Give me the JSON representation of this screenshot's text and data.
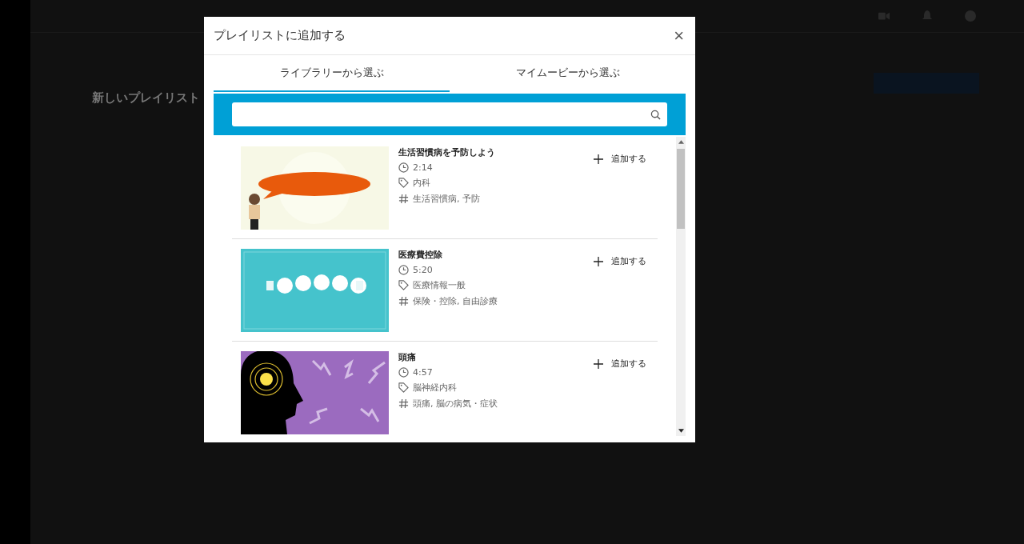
{
  "background_page": {
    "title": "新しいプレイリスト"
  },
  "dialog": {
    "title": "プレイリストに追加する",
    "close": "×",
    "tabs": [
      {
        "label": "ライブラリーから選ぶ",
        "selected": true
      },
      {
        "label": "マイムービーから選ぶ",
        "selected": false
      }
    ],
    "videos": [
      {
        "title": "生活習慣病を予防しよう",
        "duration": "2:14",
        "category": "内科",
        "tags": "生活習慣病, 予防",
        "add": "追加する"
      },
      {
        "title": "医療費控除",
        "duration": "5:20",
        "category": "医療情報一般",
        "tags": "保険・控除, 自由診療",
        "add": "追加する"
      },
      {
        "title": "頭痛",
        "duration": "4:57",
        "category": "脳神経内科",
        "tags": "頭痛, 脳の病気・症状",
        "add": "追加する"
      }
    ]
  }
}
